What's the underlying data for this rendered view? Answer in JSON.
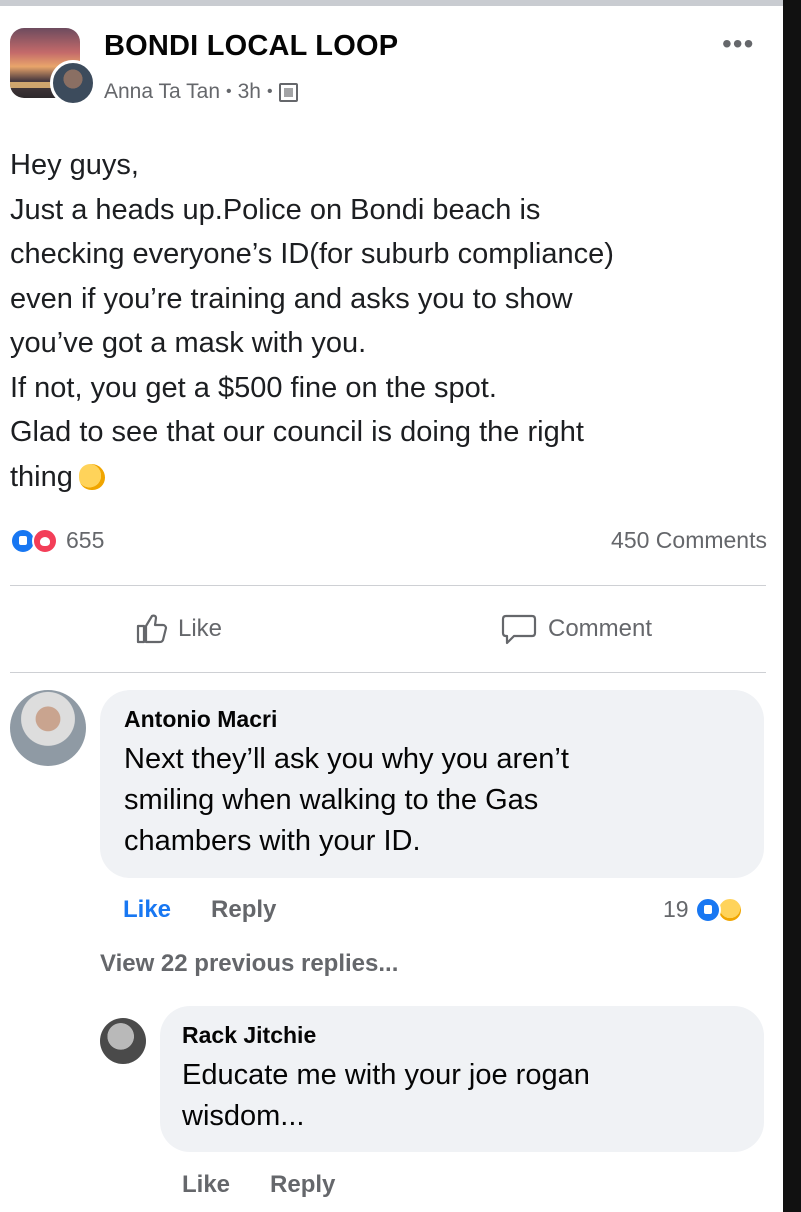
{
  "post": {
    "group_name": "BONDI LOCAL LOOP",
    "author": "Anna Ta Tan",
    "time": "3h",
    "more": "•••",
    "body_lines": [
      "Hey guys,",
      "Just a heads up.Police on Bondi beach is",
      "checking everyone’s ID(for suburb compliance)",
      "even if you’re training and asks you to show",
      "you’ve got a mask with you.",
      "If not, you get a $500 fine on the spot.",
      "Glad to see that our council is doing the right",
      "thing"
    ],
    "reaction_count": "655",
    "comments_count": "450 Comments",
    "actions": {
      "like": "Like",
      "comment": "Comment"
    }
  },
  "comments": [
    {
      "author": "Antonio Macri",
      "lines": [
        "Next they’ll ask you why you aren’t",
        "smiling when walking to the Gas",
        "chambers with your ID."
      ],
      "like": "Like",
      "reply": "Reply",
      "reaction_count": "19"
    }
  ],
  "view_previous_replies": "View 22 previous replies...",
  "reply": {
    "author": "Rack Jitchie",
    "lines": [
      "Educate me with your joe rogan",
      "wisdom..."
    ],
    "like": "Like",
    "reply": "Reply"
  },
  "colors": {
    "like_blue": "#1877f2",
    "love_red": "#f33e58",
    "meta_gray": "#65676b",
    "bubble_bg": "#f0f2f5"
  },
  "icons": [
    "more-icon",
    "globe-icon",
    "clap-emoji-icon",
    "like-reaction-icon",
    "love-reaction-icon",
    "haha-reaction-icon",
    "thumbs-up-icon",
    "comment-bubble-icon"
  ]
}
